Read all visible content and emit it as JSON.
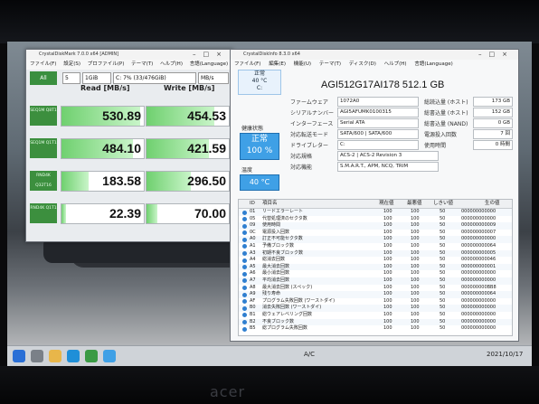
{
  "cdm": {
    "title": "CrystalDiskMark 7.0.0 x64 [ADMIN]",
    "menu": [
      "ファイル(F)",
      "設定(S)",
      "プロファイル(P)",
      "テーマ(T)",
      "ヘルプ(H)",
      "言語(Language)"
    ],
    "all_label": "All",
    "count": "5",
    "size": "1GiB",
    "drive": "C: 7% (33/476GiB)",
    "unit": "MB/s",
    "read_header": "Read [MB/s]",
    "write_header": "Write [MB/s]",
    "rows": [
      {
        "label": "SEQ1M Q8T1",
        "read": "530.89",
        "write": "454.53",
        "read_fill": 0.96,
        "write_fill": 0.82
      },
      {
        "label": "SEQ1M Q1T1",
        "read": "484.10",
        "write": "421.59",
        "read_fill": 0.87,
        "write_fill": 0.76
      },
      {
        "label": "RND4K Q32T16",
        "read": "183.58",
        "write": "296.50",
        "read_fill": 0.33,
        "write_fill": 0.54
      },
      {
        "label": "RND4K Q1T1",
        "read": "22.39",
        "write": "70.00",
        "read_fill": 0.05,
        "write_fill": 0.13
      }
    ]
  },
  "cdi": {
    "title": "CrystalDiskInfo 8.3.0 x64",
    "menu": [
      "ファイル(F)",
      "編集(E)",
      "機能(U)",
      "テーマ(T)",
      "ディスク(D)",
      "ヘルプ(H)",
      "言語(Language)"
    ],
    "tab_status": "正常",
    "tab_temp": "40 °C",
    "tab_drive": "C:",
    "model": "AGI512G17AI178 512.1 GB",
    "health_label": "健康状態",
    "health_status": "正常",
    "health_pct": "100 %",
    "temp_label": "温度",
    "temp_value": "40 °C",
    "info_labels": [
      "ファームウェア",
      "シリアルナンバー",
      "インターフェース",
      "対応転送モード",
      "ドライブレター",
      "対応規格",
      "対応機能"
    ],
    "info_values": [
      "1072A0",
      "AGI5AFUMK0100315",
      "Serial ATA",
      "SATA/600 | SATA/600",
      "C:",
      "ACS-2 | ACS-2 Revision 3",
      "S.M.A.R.T., APM, NCQ, TRIM"
    ],
    "right_labels": [
      "総読込量 (ホスト)",
      "総書込量 (ホスト)",
      "総書込量 (NAND)",
      "電源投入回数",
      "使用時間"
    ],
    "right_values": [
      "173 GB",
      "152 GB",
      "0 GB",
      "7 回",
      "0 時間"
    ],
    "smart_headers": [
      "ID",
      "項目名",
      "現在値",
      "最悪値",
      "しきい値",
      "生の値"
    ],
    "smart_rows": [
      {
        "id": "01",
        "name": "リードエラーレート",
        "cur": "100",
        "worst": "100",
        "thr": "50",
        "raw": "000000000000"
      },
      {
        "id": "05",
        "name": "代替処理済のセクタ数",
        "cur": "100",
        "worst": "100",
        "thr": "50",
        "raw": "000000000000"
      },
      {
        "id": "09",
        "name": "使用時間",
        "cur": "100",
        "worst": "100",
        "thr": "50",
        "raw": "000000000009"
      },
      {
        "id": "0C",
        "name": "電源投入回数",
        "cur": "100",
        "worst": "100",
        "thr": "50",
        "raw": "000000000007"
      },
      {
        "id": "A0",
        "name": "訂正不可能セクタ数",
        "cur": "100",
        "worst": "100",
        "thr": "50",
        "raw": "000000000000"
      },
      {
        "id": "A1",
        "name": "予備ブロック数",
        "cur": "100",
        "worst": "100",
        "thr": "50",
        "raw": "000000000064"
      },
      {
        "id": "A3",
        "name": "初期不良ブロック数",
        "cur": "100",
        "worst": "100",
        "thr": "50",
        "raw": "000000000005"
      },
      {
        "id": "A4",
        "name": "総消去回数",
        "cur": "100",
        "worst": "100",
        "thr": "50",
        "raw": "000000000046"
      },
      {
        "id": "A5",
        "name": "最大消去回数",
        "cur": "100",
        "worst": "100",
        "thr": "50",
        "raw": "000000000001"
      },
      {
        "id": "A6",
        "name": "最小消去回数",
        "cur": "100",
        "worst": "100",
        "thr": "50",
        "raw": "000000000000"
      },
      {
        "id": "A7",
        "name": "平均消去回数",
        "cur": "100",
        "worst": "100",
        "thr": "50",
        "raw": "000000000000"
      },
      {
        "id": "A8",
        "name": "最大消去回数 (スペック)",
        "cur": "100",
        "worst": "100",
        "thr": "50",
        "raw": "000000000BB8"
      },
      {
        "id": "A9",
        "name": "残り寿命",
        "cur": "100",
        "worst": "100",
        "thr": "50",
        "raw": "000000000064"
      },
      {
        "id": "AF",
        "name": "プログラム失敗回数 (ワーストダイ)",
        "cur": "100",
        "worst": "100",
        "thr": "50",
        "raw": "000000000000"
      },
      {
        "id": "B0",
        "name": "消去失敗回数 (ワーストダイ)",
        "cur": "100",
        "worst": "100",
        "thr": "50",
        "raw": "000000000000"
      },
      {
        "id": "B1",
        "name": "総ウェアレベリング回数",
        "cur": "100",
        "worst": "100",
        "thr": "50",
        "raw": "000000000000"
      },
      {
        "id": "B2",
        "name": "不良ブロック数",
        "cur": "100",
        "worst": "100",
        "thr": "50",
        "raw": "000000000000"
      },
      {
        "id": "B5",
        "name": "総プログラム失敗回数",
        "cur": "100",
        "worst": "100",
        "thr": "50",
        "raw": "000000000000"
      }
    ]
  },
  "taskbar": {
    "ime": "A/C",
    "clock": "2021/10/17"
  },
  "bezel": {
    "brand": "acer"
  }
}
